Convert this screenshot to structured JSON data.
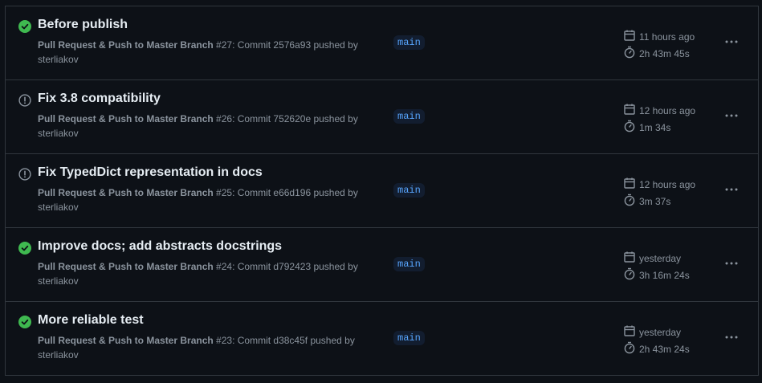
{
  "runs": [
    {
      "status": "success",
      "status_icon": "check-circle-fill-icon",
      "title": "Before publish",
      "workflow": "Pull Request & Push to Master Branch",
      "run_info": " #27: Commit 2576a93 pushed by",
      "actor": "sterliakov",
      "branch": "main",
      "started": "11 hours ago",
      "duration": "2h 43m 45s"
    },
    {
      "status": "cancelled",
      "status_icon": "alert-circle-icon",
      "title": "Fix 3.8 compatibility",
      "workflow": "Pull Request & Push to Master Branch",
      "run_info": " #26: Commit 752620e pushed by",
      "actor": "sterliakov",
      "branch": "main",
      "started": "12 hours ago",
      "duration": "1m 34s"
    },
    {
      "status": "cancelled",
      "status_icon": "alert-circle-icon",
      "title": "Fix TypedDict representation in docs",
      "workflow": "Pull Request & Push to Master Branch",
      "run_info": " #25: Commit e66d196 pushed by",
      "actor": "sterliakov",
      "branch": "main",
      "started": "12 hours ago",
      "duration": "3m 37s"
    },
    {
      "status": "success",
      "status_icon": "check-circle-fill-icon",
      "title": "Improve docs; add abstracts docstrings",
      "workflow": "Pull Request & Push to Master Branch",
      "run_info": " #24: Commit d792423 pushed by",
      "actor": "sterliakov",
      "branch": "main",
      "started": "yesterday",
      "duration": "3h 16m 24s"
    },
    {
      "status": "success",
      "status_icon": "check-circle-fill-icon",
      "title": "More reliable test",
      "workflow": "Pull Request & Push to Master Branch",
      "run_info": " #23: Commit d38c45f pushed by",
      "actor": "sterliakov",
      "branch": "main",
      "started": "yesterday",
      "duration": "2h 43m 24s"
    }
  ],
  "colors": {
    "background": "#0d1117",
    "border": "#30363d",
    "title": "#e6edf3",
    "muted": "#8b949e",
    "success": "#3fb950",
    "neutral_status": "#8b949e",
    "branch_bg": "#121d2f",
    "branch_text": "#58a6ff"
  },
  "icons": {
    "calendar": "calendar-icon",
    "duration": "stopwatch-icon",
    "more": "kebab-horizontal-icon"
  }
}
